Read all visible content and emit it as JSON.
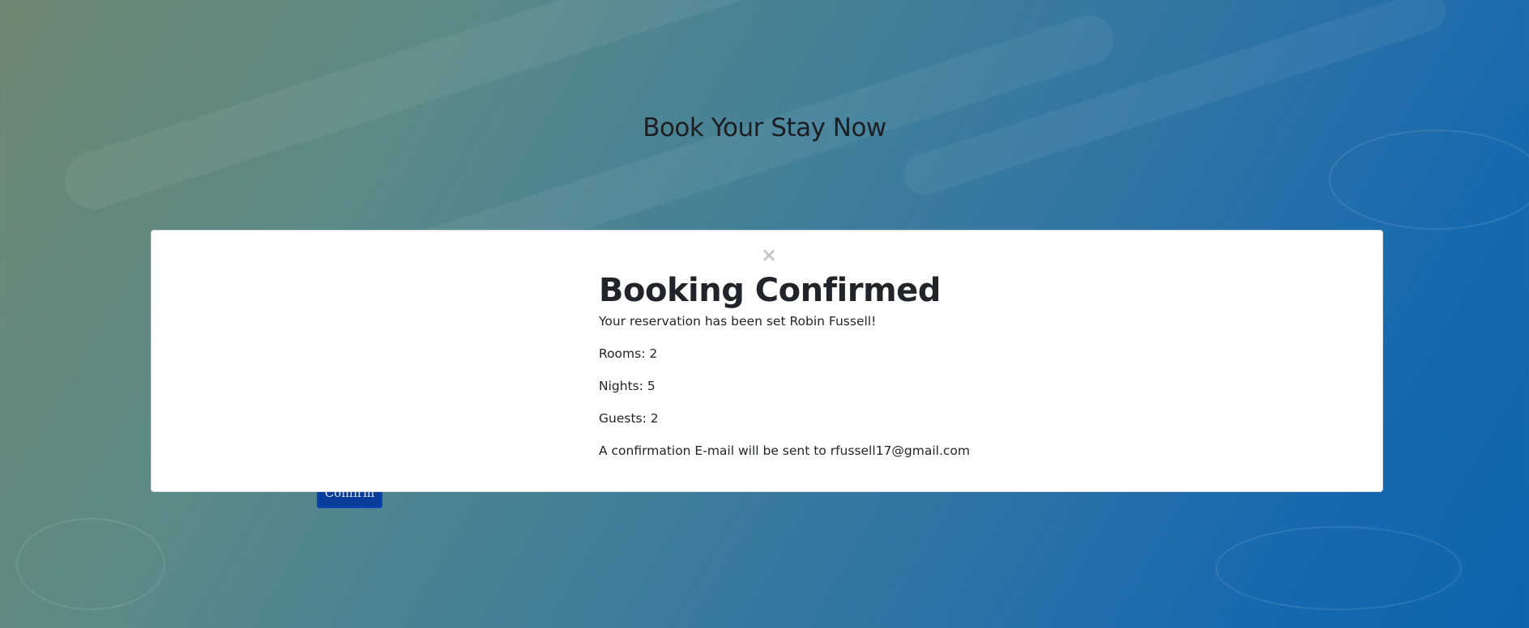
{
  "page": {
    "title": "Book Your Stay Now",
    "confirm_button_label": "Confirm"
  },
  "modal": {
    "close_symbol": "×",
    "title": "Booking Confirmed",
    "message": "Your reservation has been set Robin Fussell!",
    "rooms": "Rooms: 2",
    "nights": "Nights: 5",
    "guests": "Guests: 2",
    "email_notice": "A confirmation E-mail will be sent to rfussell17@gmail.com"
  },
  "colors": {
    "modal_background": "#ffffff",
    "confirm_button": "#0a3c9a",
    "text": "#212529"
  }
}
